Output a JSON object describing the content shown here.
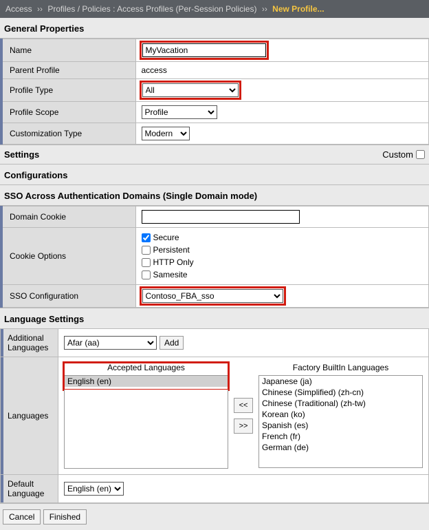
{
  "breadcrumb": {
    "root": "Access",
    "mid": "Profiles / Policies : Access Profiles (Per-Session Policies)",
    "leaf": "New Profile..."
  },
  "sections": {
    "general": "General Properties",
    "settings": "Settings",
    "custom_label": "Custom",
    "configurations": "Configurations",
    "sso_header": "SSO Across Authentication Domains (Single Domain mode)",
    "lang_settings": "Language Settings"
  },
  "general": {
    "name_label": "Name",
    "name_value": "MyVacation",
    "parent_label": "Parent Profile",
    "parent_value": "access",
    "type_label": "Profile Type",
    "type_value": "All",
    "scope_label": "Profile Scope",
    "scope_value": "Profile",
    "custom_label": "Customization Type",
    "custom_value": "Modern"
  },
  "sso": {
    "domain_cookie_label": "Domain Cookie",
    "domain_cookie_value": "",
    "cookie_options_label": "Cookie Options",
    "opt_secure": "Secure",
    "opt_persistent": "Persistent",
    "opt_httponly": "HTTP Only",
    "opt_samesite": "Samesite",
    "sso_config_label": "SSO Configuration",
    "sso_config_value": "Contoso_FBA_sso"
  },
  "lang": {
    "additional_label": "Additional Languages",
    "additional_value": "Afar (aa)",
    "add_btn": "Add",
    "languages_label": "Languages",
    "accepted_header": "Accepted Languages",
    "factory_header": "Factory BuiltIn Languages",
    "accepted_items": [
      "English (en)"
    ],
    "factory_items": [
      "Japanese (ja)",
      "Chinese (Simplified) (zh-cn)",
      "Chinese (Traditional) (zh-tw)",
      "Korean (ko)",
      "Spanish (es)",
      "French (fr)",
      "German (de)"
    ],
    "move_left": "<<",
    "move_right": ">>",
    "default_label": "Default Language",
    "default_value": "English (en)"
  },
  "footer": {
    "cancel": "Cancel",
    "finished": "Finished"
  }
}
